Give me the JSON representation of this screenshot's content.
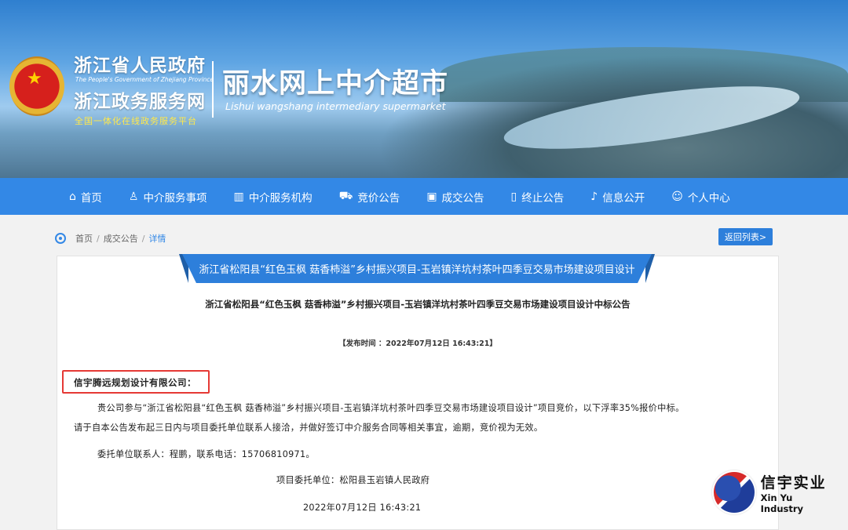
{
  "header": {
    "gov_title": "浙江省人民政府",
    "gov_en": "The People's Government of Zhejiang Province",
    "gov_sub": "浙江政务服务网",
    "gov_tag": "全国一体化在线政务服务平台",
    "site_title": "丽水网上中介超市",
    "site_en": "Lishui wangshang intermediary supermarket"
  },
  "nav": {
    "items": [
      {
        "label": "首页",
        "icon": "home-icon"
      },
      {
        "label": "中介服务事项",
        "icon": "service-icon"
      },
      {
        "label": "中介服务机构",
        "icon": "institution-icon"
      },
      {
        "label": "竞价公告",
        "icon": "cart-icon"
      },
      {
        "label": "成交公告",
        "icon": "briefcase-icon"
      },
      {
        "label": "终止公告",
        "icon": "trash-icon"
      },
      {
        "label": "信息公开",
        "icon": "bell-icon"
      },
      {
        "label": "个人中心",
        "icon": "user-icon"
      }
    ]
  },
  "breadcrumb": {
    "home": "首页",
    "sep": "/",
    "section": "成交公告",
    "current": "详情"
  },
  "back_button": "返回列表>",
  "ribbon_title": "浙江省松阳县“红色玉枫 菇香柿溢”乡村振兴项目-玉岩镇洋坑村茶叶四季豆交易市场建设项目设计",
  "doc": {
    "title": "浙江省松阳县“红色玉枫  菇香柿溢”乡村振兴项目-玉岩镇洋坑村茶叶四季豆交易市场建设项目设计中标公告",
    "publish_time": "【发布时间 ：2022年07月12日  16:43:21】",
    "addressee": "信宇腾远规划设计有限公司：",
    "para1": "贵公司参与“浙江省松阳县“红色玉枫  菇香柿溢”乡村振兴项目-玉岩镇洋坑村茶叶四季豆交易市场建设项目设计”项目竞价，以下浮率35%报价中标。",
    "para2": "请于自本公告发布起三日内与项目委托单位联系人接洽，并做好签订中介服务合同等相关事宜，逾期，竞价视为无效。",
    "contact": "委托单位联系人：程鹏，联系电话：15706810971。",
    "org": "项目委托单位：松阳县玉岩镇人民政府",
    "date": "2022年07月12日  16:43:21"
  },
  "watermark": {
    "cn": "信宇实业",
    "en": "Xin Yu Industry"
  },
  "colors": {
    "nav": "#3388e6",
    "accent": "#2d7fdb",
    "highlight_box": "#e53935"
  }
}
